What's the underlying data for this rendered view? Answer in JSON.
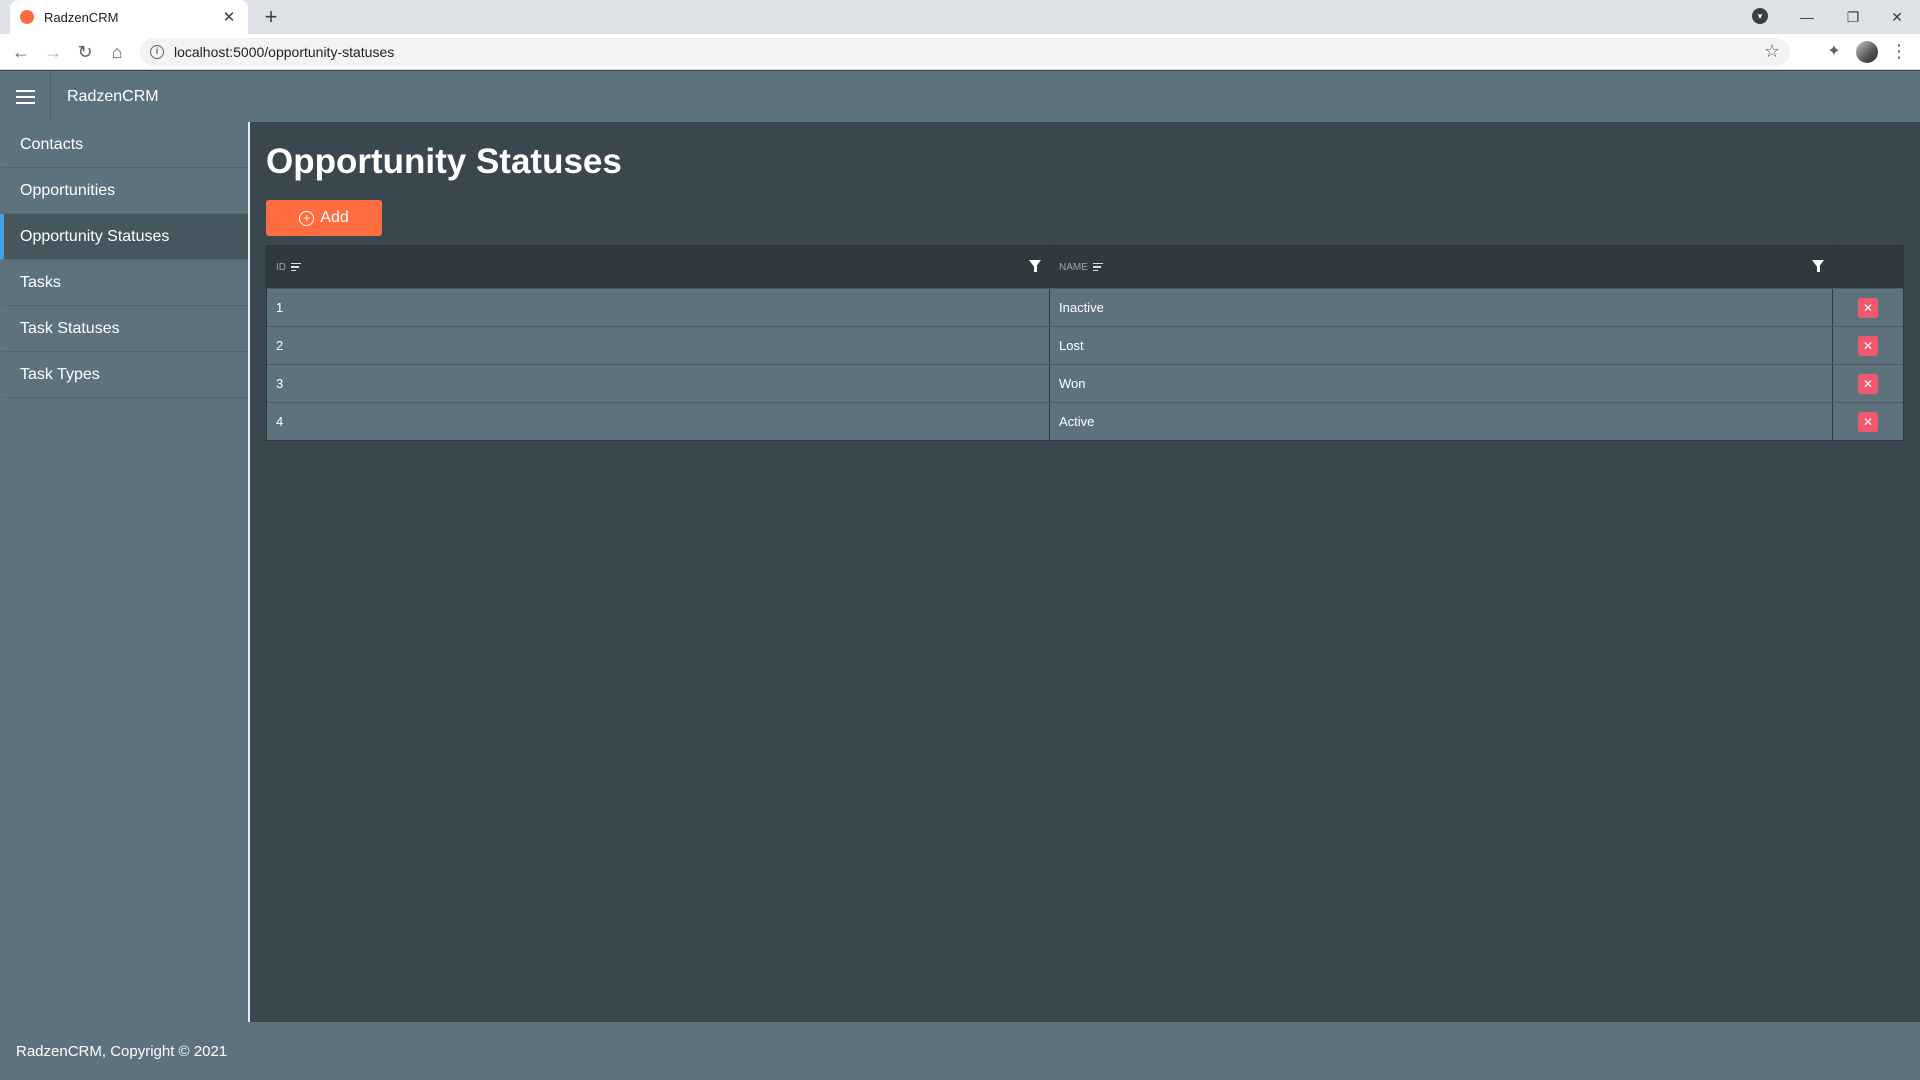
{
  "browser": {
    "tab_title": "RadzenCRM",
    "tab_close": "✕",
    "new_tab": "+",
    "url": "localhost:5000/opportunity-statuses",
    "window_controls": [
      "—",
      "❐",
      "✕"
    ]
  },
  "app": {
    "brand": "RadzenCRM",
    "accent_color": "#ff6d41",
    "header_color": "#5e727d"
  },
  "sidebar": {
    "items": [
      {
        "label": "Contacts"
      },
      {
        "label": "Opportunities"
      },
      {
        "label": "Opportunity Statuses",
        "active": true
      },
      {
        "label": "Tasks"
      },
      {
        "label": "Task Statuses"
      },
      {
        "label": "Task Types"
      }
    ]
  },
  "main": {
    "title": "Opportunity Statuses",
    "add_label": "Add",
    "columns": [
      "ID",
      "Name"
    ],
    "rows": [
      {
        "id": "1",
        "name": "Inactive"
      },
      {
        "id": "2",
        "name": "Lost"
      },
      {
        "id": "3",
        "name": "Won"
      },
      {
        "id": "4",
        "name": "Active"
      }
    ],
    "delete_glyph": "✕"
  },
  "footer": {
    "text": "RadzenCRM, Copyright © 2021"
  }
}
